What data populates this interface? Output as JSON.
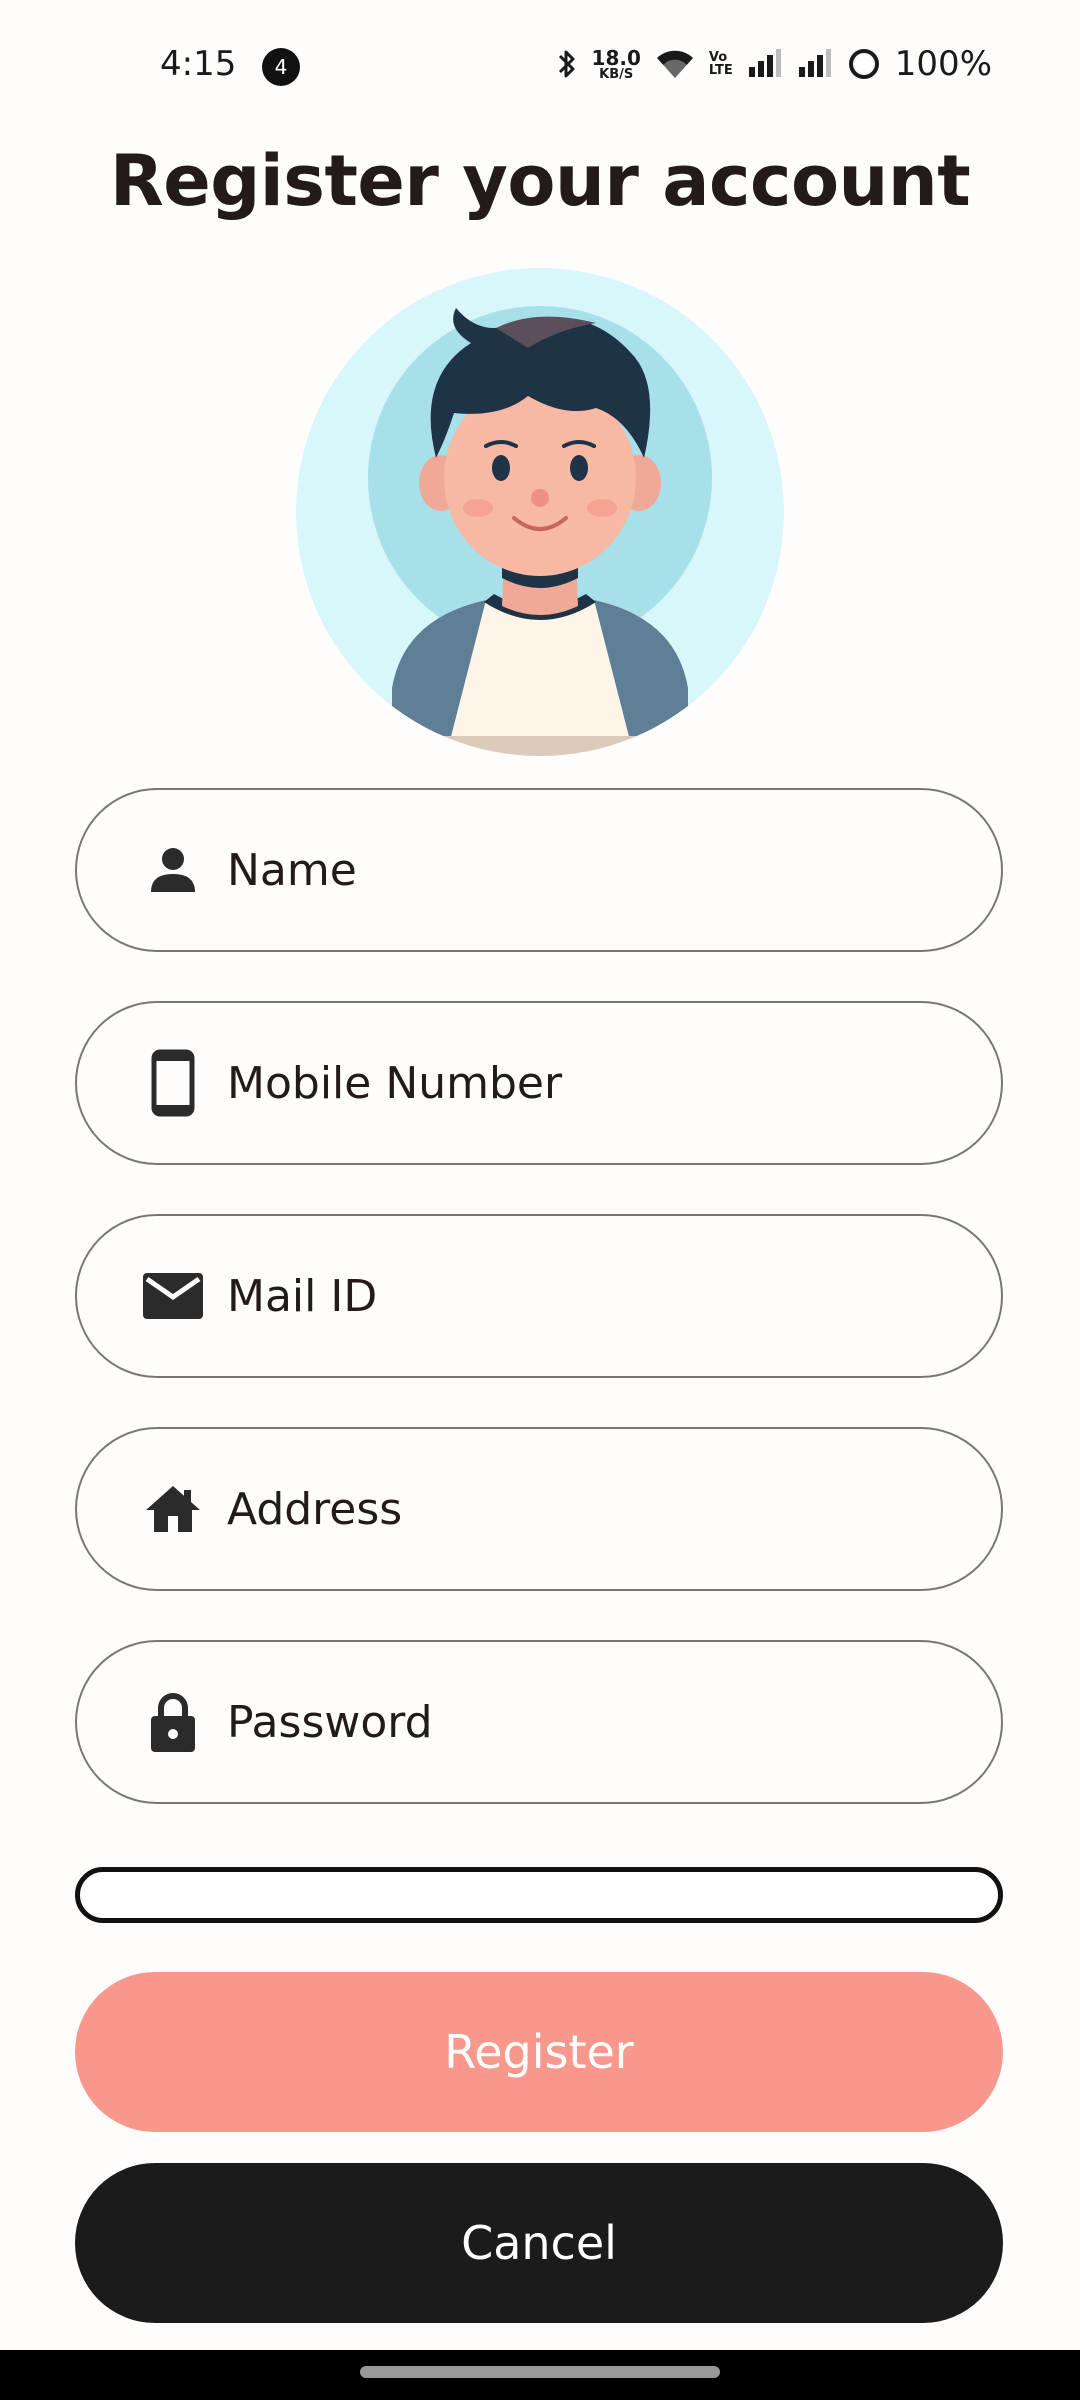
{
  "status_bar": {
    "time": "4:15",
    "notification_count": "4",
    "net_speed_value": "18.0",
    "net_speed_unit": "KB/S",
    "volte_top": "Vo",
    "volte_bottom": "LTE",
    "battery_percent": "100%"
  },
  "title": "Register your account",
  "form": {
    "name": {
      "placeholder": "Name",
      "icon": "person-icon"
    },
    "mobile": {
      "placeholder": "Mobile Number",
      "icon": "phone-icon"
    },
    "mail": {
      "placeholder": "Mail ID",
      "icon": "mail-icon"
    },
    "address": {
      "placeholder": "Address",
      "icon": "home-icon"
    },
    "password": {
      "placeholder": "Password",
      "icon": "lock-icon"
    }
  },
  "buttons": {
    "register": "Register",
    "cancel": "Cancel"
  },
  "colors": {
    "register": "#f8988c",
    "cancel": "#1b1b1b",
    "field_border": "#7d7476"
  }
}
